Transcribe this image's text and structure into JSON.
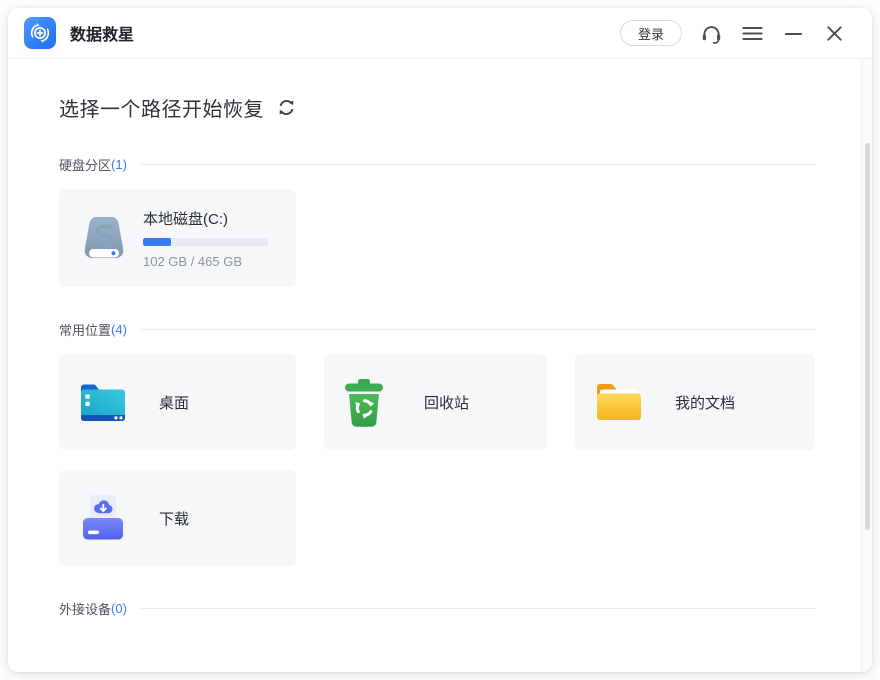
{
  "titlebar": {
    "app_title": "数据救星",
    "login_label": "登录"
  },
  "main": {
    "title": "选择一个路径开始恢复",
    "sections": [
      {
        "label": "硬盘分区",
        "count_text": "(1)"
      },
      {
        "label": "常用位置",
        "count_text": "(4)"
      },
      {
        "label": "外接设备",
        "count_text": "(0)"
      }
    ],
    "disk": {
      "name": "本地磁盘(C:)",
      "size_text": "102 GB / 465 GB",
      "used": "102 GB",
      "total": "465 GB",
      "usage_percent": 22,
      "fill_style": "width:22%"
    },
    "locations": [
      {
        "label": "桌面",
        "icon": "desktop-folder-icon"
      },
      {
        "label": "回收站",
        "icon": "recycle-bin-icon"
      },
      {
        "label": "我的文档",
        "icon": "documents-folder-icon"
      },
      {
        "label": "下载",
        "icon": "downloads-tray-icon"
      }
    ]
  },
  "colors": {
    "accent_blue": "#3a7af0",
    "logo_blue": "#2d7bf7",
    "progress_track": "#e7eaf0",
    "card_bg": "#f5f7f9",
    "hard_drive_icon": "#8ba3bc",
    "desktop_folder_teal": "#2bbcd7",
    "desktop_folder_navy": "#1258b8",
    "recycle_green": "#3fae51",
    "documents_yellow": "#f8c226",
    "documents_orange": "#f59a0b",
    "downloads_indigo": "#5b6bf2",
    "text_dark": "#2b2f34",
    "text_gray": "#8d949e"
  }
}
